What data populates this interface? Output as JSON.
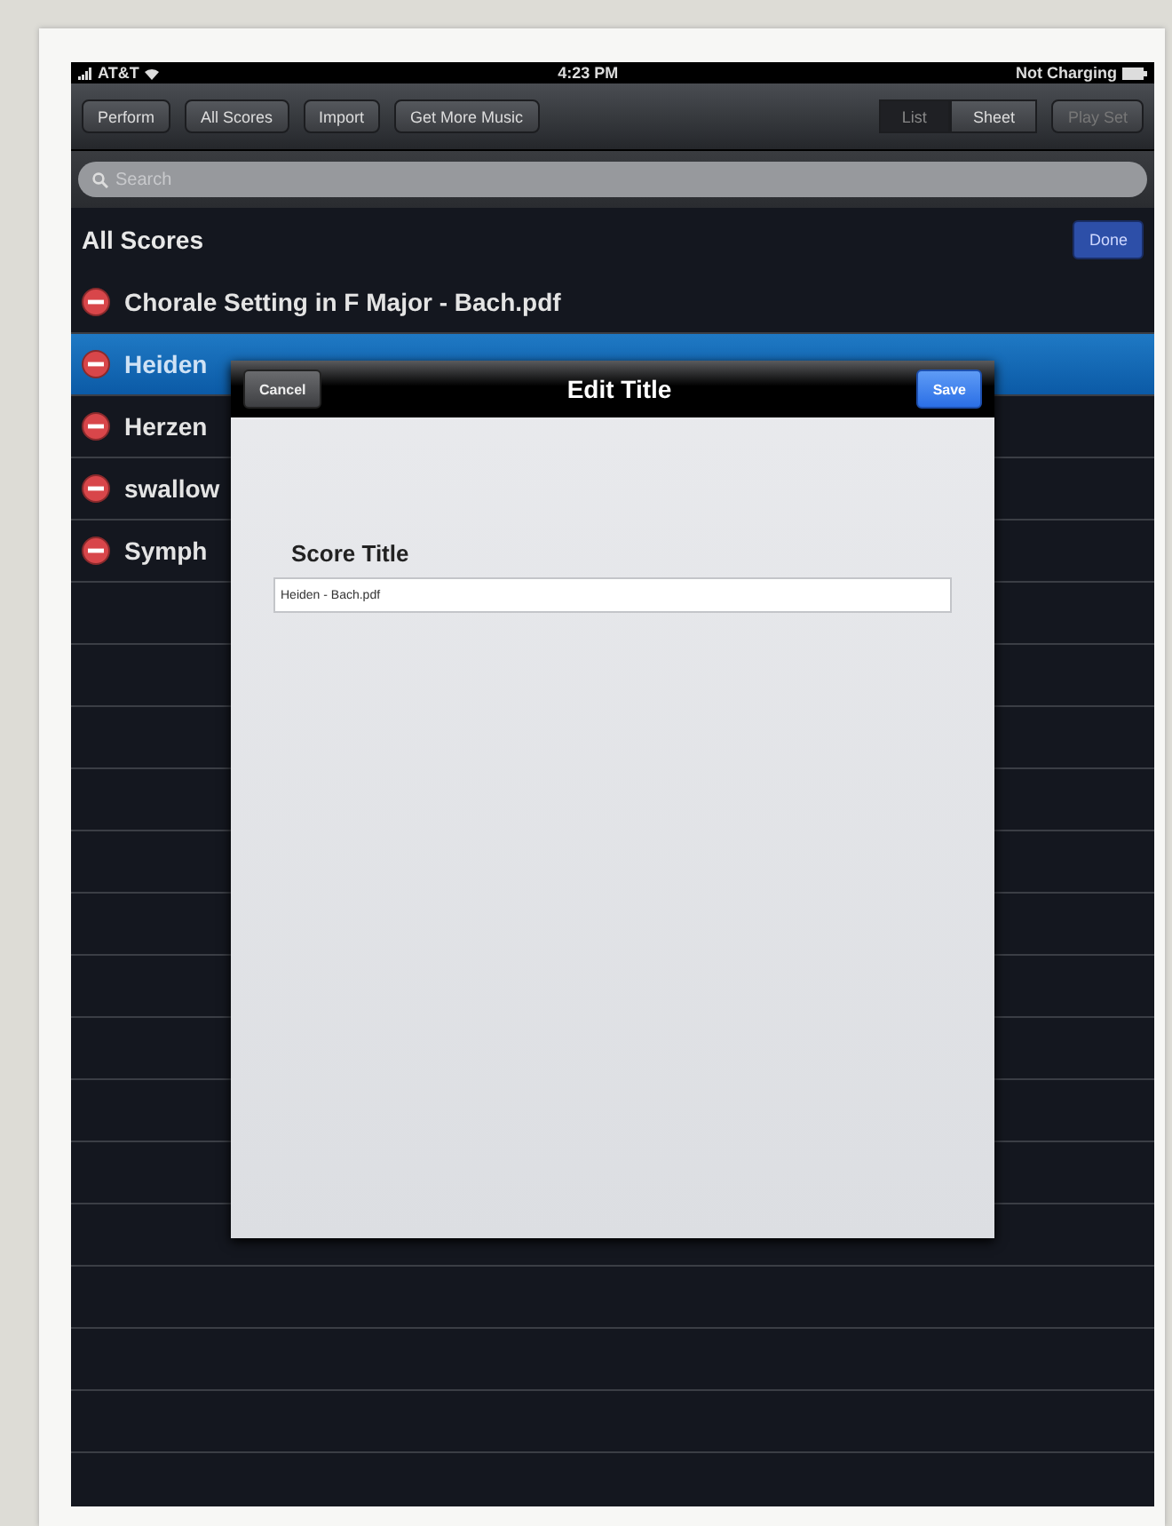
{
  "status_bar": {
    "carrier": "AT&T",
    "time": "4:23 PM",
    "battery_text": "Not Charging"
  },
  "toolbar": {
    "buttons": [
      {
        "label": "Perform",
        "disabled": false
      },
      {
        "label": "All Scores",
        "disabled": false
      },
      {
        "label": "Import",
        "disabled": false
      },
      {
        "label": "Get More Music",
        "disabled": false
      }
    ],
    "view_segments": [
      {
        "label": "List",
        "selected": true
      },
      {
        "label": "Sheet",
        "selected": false
      }
    ],
    "play_set": {
      "label": "Play Set",
      "disabled": true
    }
  },
  "search": {
    "placeholder": "Search"
  },
  "list": {
    "title": "All Scores",
    "done_button": "Done",
    "rows": [
      {
        "title": "Chorale Setting in F Major - Bach.pdf",
        "selected": false
      },
      {
        "title": "Heiden",
        "selected": true
      },
      {
        "title": "Herzen",
        "selected": false
      },
      {
        "title": "swallow",
        "selected": false
      },
      {
        "title": "Symph",
        "selected": false
      }
    ]
  },
  "dialog": {
    "title": "Edit Title",
    "cancel": "Cancel",
    "save": "Save",
    "field_label": "Score Title",
    "field_value": "Heiden - Bach.pdf"
  }
}
